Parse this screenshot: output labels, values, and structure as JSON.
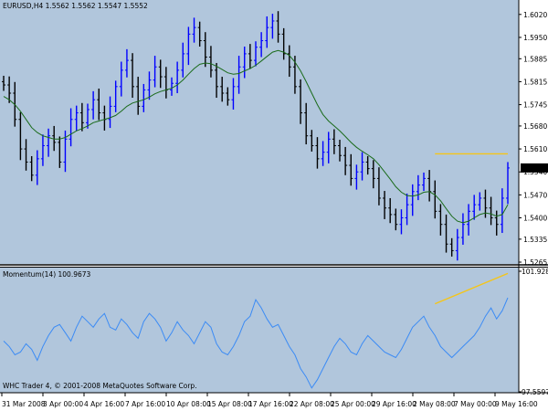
{
  "colors": {
    "background": "#b1c6dc",
    "bull_bar": "#0000ff",
    "bear_bar": "#000000",
    "moving_average": "#1a6b1a",
    "momentum_line": "#3b8bf5",
    "trend_line": "#f5c518",
    "price_marker_bg": "#000000",
    "price_marker_text": "#ffffff"
  },
  "chart_data": [
    {
      "type": "candlestick",
      "title": "EURUSD,H4  1.5562 1.5562 1.5547 1.5552",
      "symbol": "EURUSD",
      "timeframe": "H4",
      "ohlc_last": {
        "open": 1.5562,
        "high": 1.5562,
        "low": 1.5547,
        "close": 1.5552
      },
      "current_price_label": "1.5552",
      "ylim": [
        1.5265,
        1.6025
      ],
      "y_ticks": [
        "1.6020",
        "1.5950",
        "1.5885",
        "1.5815",
        "1.5745",
        "1.5680",
        "1.5610",
        "1.5540",
        "1.5470",
        "1.5400",
        "1.5335",
        "1.5265"
      ],
      "x_ticks": [
        "31 Mar 2008",
        "3 Apr 00:00",
        "4 Apr 16:00",
        "7 Apr 16:00",
        "10 Apr 08:00",
        "15 Apr 08:00",
        "17 Apr 16:00",
        "22 Apr 08:00",
        "25 Apr 00:00",
        "29 Apr 16:00",
        "2 May 08:00",
        "7 May 00:00",
        "9 May 16:00"
      ],
      "series": [
        {
          "name": "close",
          "values": [
            1.5805,
            1.578,
            1.57,
            1.561,
            1.557,
            1.553,
            1.558,
            1.562,
            1.565,
            1.563,
            1.557,
            1.564,
            1.57,
            1.572,
            1.569,
            1.573,
            1.576,
            1.572,
            1.57,
            1.574,
            1.58,
            1.585,
            1.588,
            1.58,
            1.574,
            1.579,
            1.582,
            1.586,
            1.583,
            1.579,
            1.581,
            1.585,
            1.59,
            1.596,
            1.598,
            1.594,
            1.589,
            1.585,
            1.58,
            1.578,
            1.576,
            1.58,
            1.586,
            1.59,
            1.588,
            1.592,
            1.594,
            1.598,
            1.6,
            1.596,
            1.59,
            1.586,
            1.58,
            1.572,
            1.565,
            1.562,
            1.558,
            1.56,
            1.564,
            1.562,
            1.559,
            1.556,
            1.552,
            1.554,
            1.557,
            1.555,
            1.552,
            1.546,
            1.543,
            1.541,
            1.538,
            1.54,
            1.544,
            1.548,
            1.55,
            1.552,
            1.548,
            1.542,
            1.538,
            1.532,
            1.53,
            1.534,
            1.538,
            1.542,
            1.544,
            1.546,
            1.543,
            1.54,
            1.538,
            1.546,
            1.5552
          ]
        },
        {
          "name": "moving_average",
          "values": [
            1.577,
            1.576,
            1.5745,
            1.5725,
            1.57,
            1.5675,
            1.566,
            1.565,
            1.5645,
            1.564,
            1.564,
            1.5645,
            1.5655,
            1.5665,
            1.5672,
            1.568,
            1.569,
            1.5695,
            1.57,
            1.5705,
            1.5712,
            1.5725,
            1.574,
            1.575,
            1.5755,
            1.576,
            1.5768,
            1.5778,
            1.5785,
            1.579,
            1.5795,
            1.5805,
            1.582,
            1.5838,
            1.5855,
            1.5868,
            1.5872,
            1.587,
            1.5862,
            1.5852,
            1.5842,
            1.5838,
            1.584,
            1.5848,
            1.5855,
            1.5865,
            1.5878,
            1.5892,
            1.5905,
            1.591,
            1.5905,
            1.5895,
            1.5875,
            1.5848,
            1.5815,
            1.578,
            1.5745,
            1.5715,
            1.5695,
            1.568,
            1.5665,
            1.5648,
            1.563,
            1.5615,
            1.5603,
            1.5592,
            1.558,
            1.5562,
            1.554,
            1.5518,
            1.5495,
            1.5478,
            1.5468,
            1.5466,
            1.547,
            1.5478,
            1.548,
            1.547,
            1.5452,
            1.5428,
            1.5405,
            1.539,
            1.5385,
            1.539,
            1.54,
            1.541,
            1.5415,
            1.5412,
            1.5405,
            1.541,
            1.544
          ]
        }
      ],
      "trend_line": {
        "from_index": 77,
        "to_index": 90,
        "value": 1.5595
      }
    },
    {
      "type": "line",
      "title": "Momentum(14) 100.9673",
      "ylim": [
        97.5597,
        101.9283
      ],
      "y_ticks": [
        "101.9283",
        "97.5597"
      ],
      "series": [
        {
          "name": "Momentum(14)",
          "values": [
            99.4,
            99.2,
            98.9,
            99.0,
            99.3,
            99.1,
            98.7,
            99.2,
            99.6,
            99.9,
            100.0,
            99.7,
            99.4,
            99.9,
            100.3,
            100.1,
            99.9,
            100.2,
            100.4,
            99.9,
            99.8,
            100.2,
            100.0,
            99.7,
            99.5,
            100.1,
            100.4,
            100.2,
            99.9,
            99.4,
            99.7,
            100.1,
            99.8,
            99.6,
            99.3,
            99.7,
            100.1,
            99.9,
            99.3,
            99.0,
            98.9,
            99.2,
            99.6,
            100.1,
            100.3,
            100.9,
            100.6,
            100.2,
            99.9,
            100.0,
            99.6,
            99.2,
            98.9,
            98.4,
            98.1,
            97.7,
            98.0,
            98.4,
            98.8,
            99.2,
            99.5,
            99.3,
            99.0,
            98.9,
            99.3,
            99.6,
            99.4,
            99.2,
            99.0,
            98.9,
            98.8,
            99.1,
            99.5,
            99.9,
            100.1,
            100.3,
            99.9,
            99.6,
            99.2,
            99.0,
            98.8,
            99.0,
            99.2,
            99.4,
            99.6,
            99.9,
            100.3,
            100.6,
            100.2,
            100.5,
            100.97
          ]
        }
      ],
      "trend_line": {
        "from_index": 77,
        "to_index": 90,
        "from_value": 100.75,
        "to_value": 101.85
      }
    }
  ],
  "copyright": "WHC Trader 4, © 2001-2008 MetaQuotes Software Corp."
}
